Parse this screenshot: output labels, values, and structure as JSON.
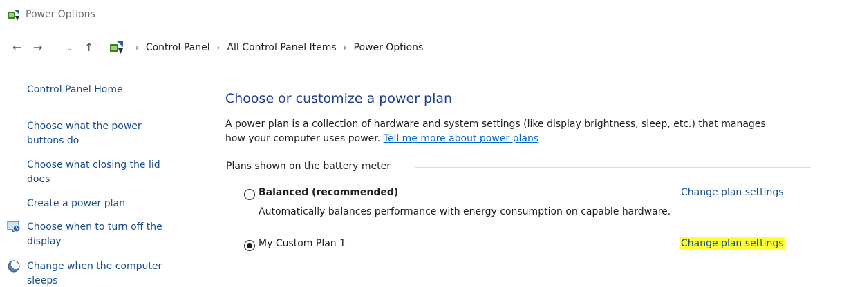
{
  "window": {
    "title": "Power Options",
    "icon": "power-options-icon"
  },
  "address_bar": {
    "back_icon": "arrow-left-icon",
    "forward_icon": "arrow-right-icon",
    "recent_icon": "chevron-down-icon",
    "up_icon": "arrow-up-icon",
    "breadcrumbs": [
      "Control Panel",
      "All Control Panel Items",
      "Power Options"
    ]
  },
  "sidebar": {
    "items": [
      {
        "label": "Control Panel Home"
      },
      {
        "label_line1": "Choose what the power",
        "label_line2": "buttons do"
      },
      {
        "label_line1": "Choose what closing the lid",
        "label_line2": "does"
      },
      {
        "label": "Create a power plan"
      },
      {
        "label_line1": "Choose when to turn off the",
        "label_line2": "display",
        "icon": "display-timer-icon"
      },
      {
        "label_line1": "Change when the computer",
        "label_line2": "sleeps",
        "icon": "moon-sleep-icon"
      }
    ]
  },
  "main": {
    "heading": "Choose or customize a power plan",
    "description_line1": "A power plan is a collection of hardware and system settings (like display brightness, sleep, etc.) that manages",
    "description_line2": "how your computer uses power.",
    "description_link": "Tell me more about power plans",
    "group_label": "Plans shown on the battery meter",
    "plans": [
      {
        "name": "Balanced (recommended)",
        "description": "Automatically balances performance with energy consumption on capable hardware.",
        "selected": false,
        "link": "Change plan settings"
      },
      {
        "name": "My Custom Plan 1",
        "selected": true,
        "link": "Change plan settings"
      }
    ]
  },
  "colors": {
    "link": "#1a4e8a",
    "heading": "#1e3d8a",
    "highlight": "#ffff33"
  }
}
